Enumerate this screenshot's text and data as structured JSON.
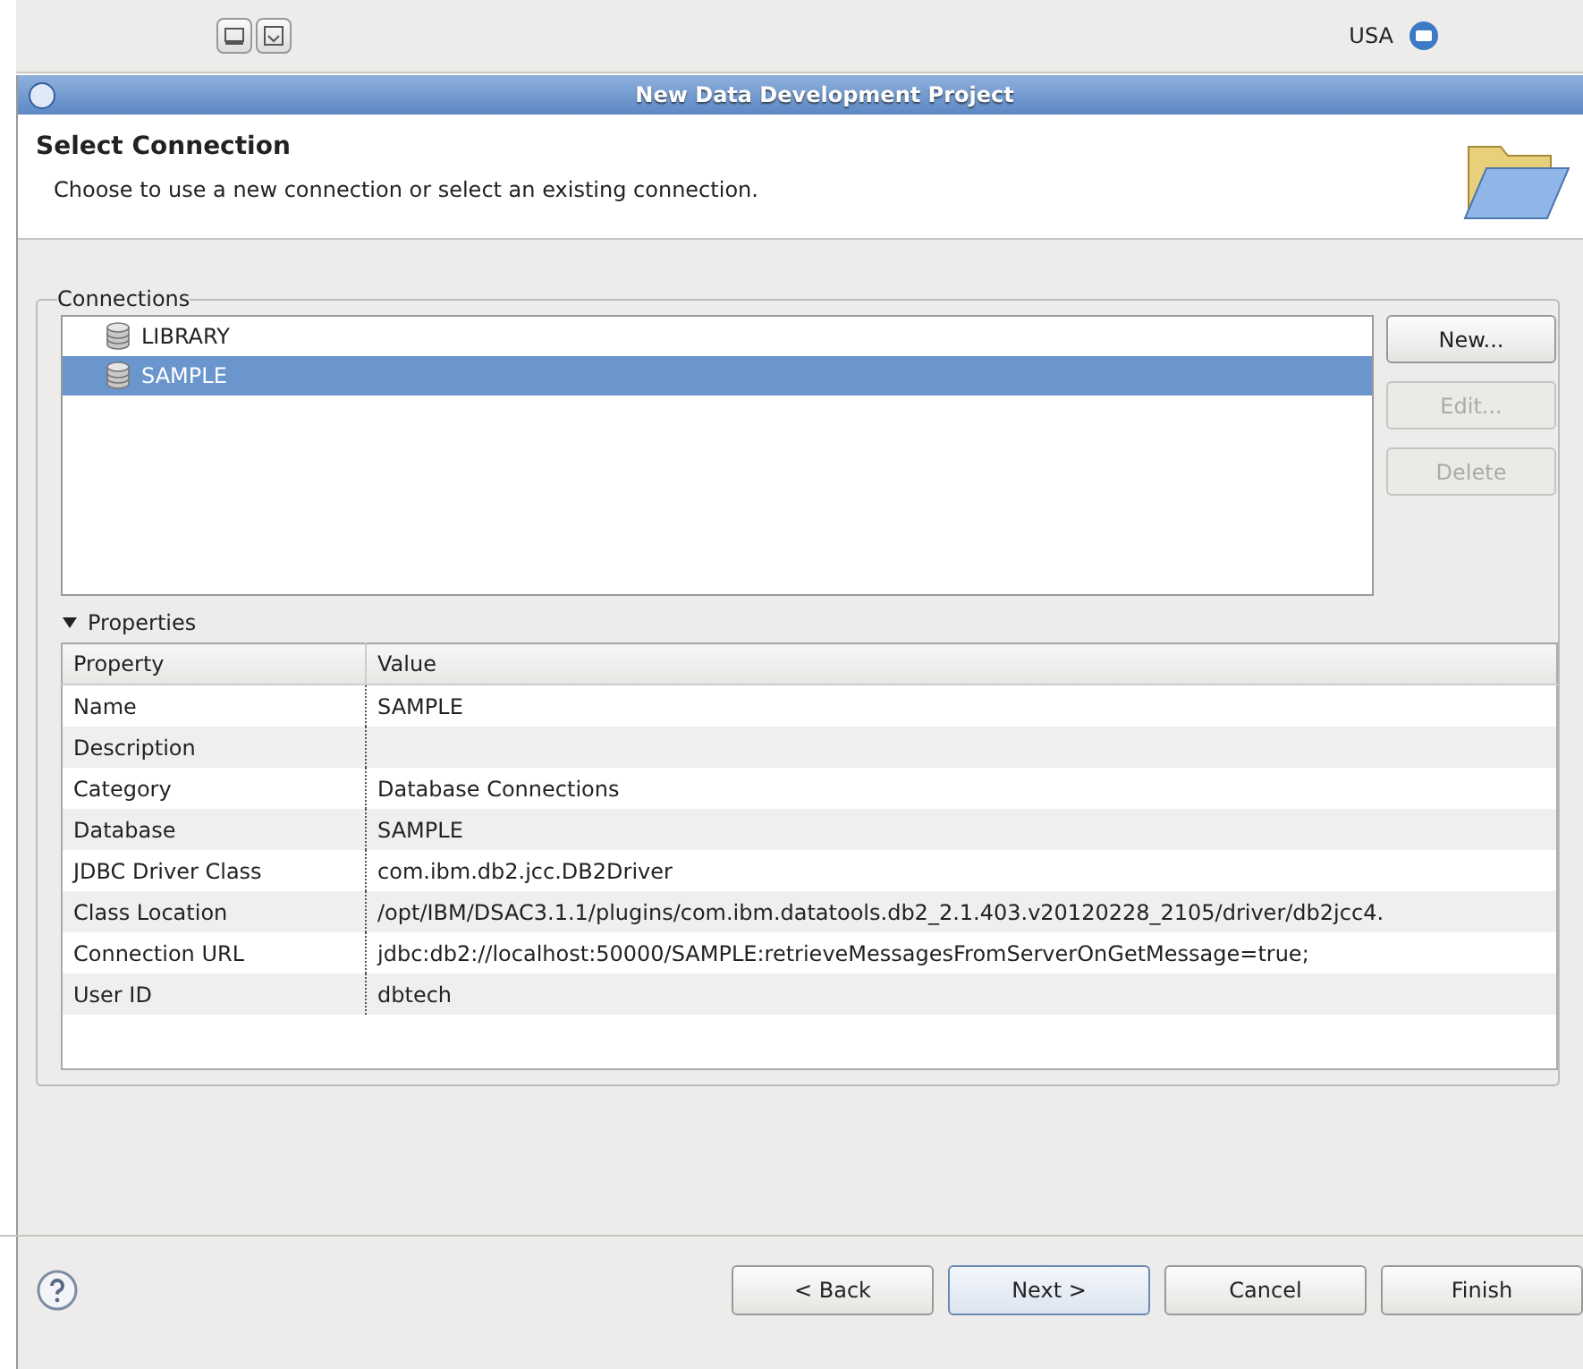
{
  "top_bar": {
    "region": "USA"
  },
  "window": {
    "title": "New Data Development Project"
  },
  "header": {
    "title": "Select Connection",
    "description": "Choose to use a new connection or select an existing connection."
  },
  "connections": {
    "label": "Connections",
    "items": [
      {
        "label": "LIBRARY",
        "selected": false
      },
      {
        "label": "SAMPLE",
        "selected": true
      }
    ],
    "buttons": [
      {
        "label": "New...",
        "disabled": false
      },
      {
        "label": "Edit...",
        "disabled": true
      },
      {
        "label": "Delete",
        "disabled": true
      }
    ]
  },
  "properties": {
    "label": "Properties",
    "expanded": true,
    "columns": [
      "Property",
      "Value"
    ],
    "rows": [
      [
        "Name",
        "SAMPLE"
      ],
      [
        "Description",
        ""
      ],
      [
        "Category",
        "Database Connections"
      ],
      [
        "Database",
        "SAMPLE"
      ],
      [
        "JDBC Driver Class",
        "com.ibm.db2.jcc.DB2Driver"
      ],
      [
        "Class Location",
        "/opt/IBM/DSAC3.1.1/plugins/com.ibm.datatools.db2_2.1.403.v20120228_2105/driver/db2jcc4."
      ],
      [
        "Connection URL",
        "jdbc:db2://localhost:50000/SAMPLE:retrieveMessagesFromServerOnGetMessage=true;"
      ],
      [
        "User ID",
        "dbtech"
      ]
    ]
  },
  "buttons": [
    {
      "label": "< Back",
      "default": false
    },
    {
      "label": "Next >",
      "default": true
    },
    {
      "label": "Cancel",
      "default": false
    },
    {
      "label": "Finish",
      "default": false
    }
  ]
}
